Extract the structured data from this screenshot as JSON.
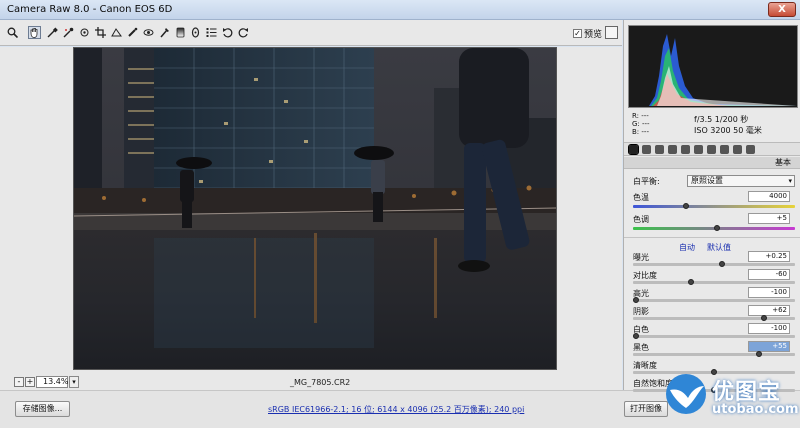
{
  "window": {
    "title": "Camera Raw 8.0 -  Canon EOS 6D",
    "close_glyph": "X"
  },
  "toolbar": {
    "tools": [
      "zoom-icon",
      "hand-icon",
      "white-balance-icon",
      "color-sampler-icon",
      "target-adjust-icon",
      "crop-icon",
      "straighten-icon",
      "spot-removal-icon",
      "red-eye-icon",
      "adjustment-brush-icon",
      "graduated-filter-icon",
      "radial-filter-icon",
      "preferences-icon",
      "rotate-left-icon",
      "rotate-right-icon"
    ],
    "preview_label": "预览",
    "preview_checked": true
  },
  "status": {
    "zoom_value": "13.4%",
    "minus": "-",
    "plus": "+",
    "filename": "_MG_7805.CR2"
  },
  "bottom": {
    "save_label": "存储图像...",
    "workflow_text": "sRGB IEC61966-2.1; 16 位; 6144 x 4096 (25.2 百万像素); 240 ppi",
    "open_label": "打开图像"
  },
  "info": {
    "r": "R:  ---",
    "g": "G:  ---",
    "b": "B:  ---",
    "aperture_shutter": "f/3.5   1/200 秒",
    "iso_lens": "ISO 3200   50 毫米"
  },
  "panel": {
    "section_title": "基本",
    "wb_label": "白平衡:",
    "wb_value": "原照设置",
    "temp_label": "色温",
    "temp_value": "4000",
    "tint_label": "色调",
    "tint_value": "+5",
    "auto_label": "自动",
    "default_label": "默认值",
    "sliders": [
      {
        "label": "曝光",
        "value": "+0.25",
        "pos": 0.55
      },
      {
        "label": "对比度",
        "value": "-60",
        "pos": 0.35
      },
      {
        "label": "高光",
        "value": "-100",
        "pos": 0.0
      },
      {
        "label": "阴影",
        "value": "+62",
        "pos": 0.82
      },
      {
        "label": "白色",
        "value": "-100",
        "pos": 0.0
      },
      {
        "label": "黑色",
        "value": "+55",
        "pos": 0.79
      },
      {
        "label": "清晰度",
        "value": "",
        "pos": 0.5
      },
      {
        "label": "自然饱和度",
        "value": "",
        "pos": 0.5
      }
    ],
    "temp_pos": 0.32,
    "tint_pos": 0.52
  },
  "watermark": {
    "cn": "优图宝",
    "en": "utobao.com"
  },
  "colors": {
    "title_bg": "#c3d4ea",
    "panel_bg": "#e9e9e9",
    "link": "#1a2fb0",
    "focus": "#7da4d8"
  }
}
